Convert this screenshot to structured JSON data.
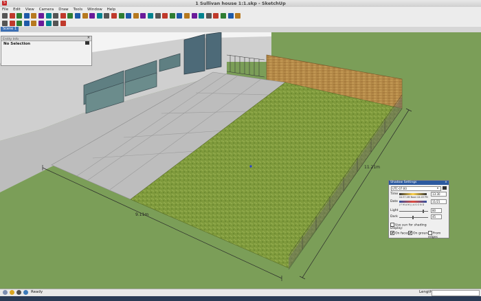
{
  "window": {
    "title": "1 Sullivan house 1:1.skp - SketchUp",
    "app_icon": "sketchup-icon",
    "accent": "#2c5aa0"
  },
  "menubar": {
    "items": [
      "File",
      "Edit",
      "View",
      "Camera",
      "Draw",
      "Tools",
      "Window",
      "Help"
    ]
  },
  "toolbar": {
    "row1": [
      "select-icon",
      "eraser-icon",
      "paint-bucket-icon",
      "make-component-icon",
      "line-icon",
      "freehand-icon",
      "rectangle-icon",
      "circle-icon",
      "arc-icon",
      "polygon-icon",
      "push-pull-icon",
      "follow-me-icon",
      "move-icon",
      "rotate-icon",
      "scale-icon",
      "offset-icon",
      "tape-measure-icon",
      "dimension-icon",
      "protractor-icon",
      "text-icon",
      "axes-icon",
      "3d-text-icon",
      "orbit-icon",
      "pan-icon",
      "zoom-icon",
      "zoom-window-icon",
      "zoom-extents-icon",
      "previous-view-icon",
      "next-view-icon",
      "position-camera-icon",
      "walk-icon",
      "look-around-icon",
      "section-plane-icon"
    ],
    "row2": [
      "iso-view-icon",
      "top-view-icon",
      "front-view-icon",
      "right-view-icon",
      "back-view-icon",
      "left-view-icon",
      "components-icon",
      "materials-icon",
      "styles-icon"
    ]
  },
  "scenes": {
    "tabs": [
      "Scene 1"
    ]
  },
  "entity_info": {
    "title": "Entity Info",
    "selection": "No Selection"
  },
  "viewport": {
    "dim_width": "9.11m",
    "dim_length": "11.21m"
  },
  "shadow_settings": {
    "title": "Shadow Settings",
    "timezone": "UTC-07:00",
    "time_label": "Time",
    "time_value": "13:30",
    "time_ticks": "04:37 AM Noon 04:49 PM",
    "date_label": "Date",
    "date_value": "11/21",
    "date_ticks": "J F M A M J J A S O N D",
    "light_label": "Light",
    "light_value": "80",
    "light_level": 0.8,
    "dark_label": "Dark",
    "dark_value": "45",
    "dark_level": 0.45,
    "use_sun_label": "Use sun for shading",
    "display_label": "Display:",
    "on_faces": "On faces",
    "on_ground": "On ground",
    "from_edges": "From edges"
  },
  "status": {
    "text": "Ready",
    "measure_label": "Length"
  }
}
